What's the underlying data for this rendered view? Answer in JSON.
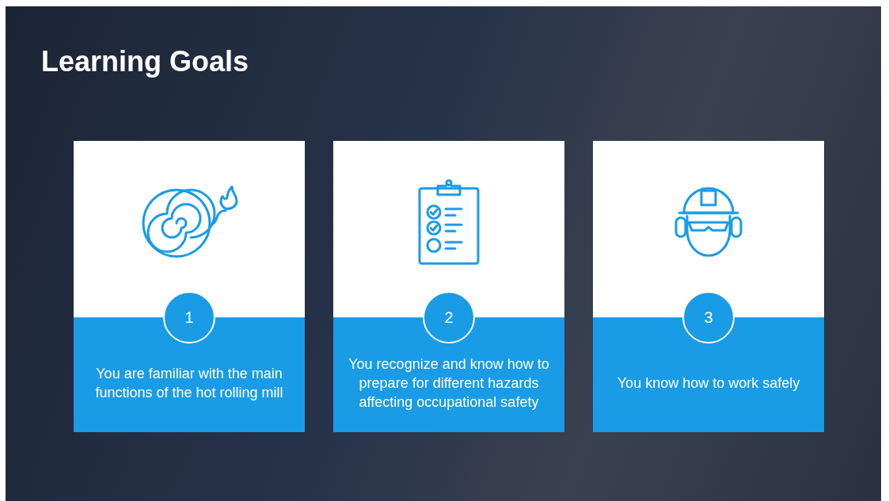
{
  "slide": {
    "title": "Learning Goals"
  },
  "goals": [
    {
      "kind": "hose",
      "number": "1",
      "text": "You are familiar with the main functions of the hot rolling mill"
    },
    {
      "kind": "checklist",
      "number": "2",
      "text": "You recognize and know how to prepare for different hazards affecting occupational safety"
    },
    {
      "kind": "worker",
      "number": "3",
      "text": "You know how to work safely"
    }
  ]
}
